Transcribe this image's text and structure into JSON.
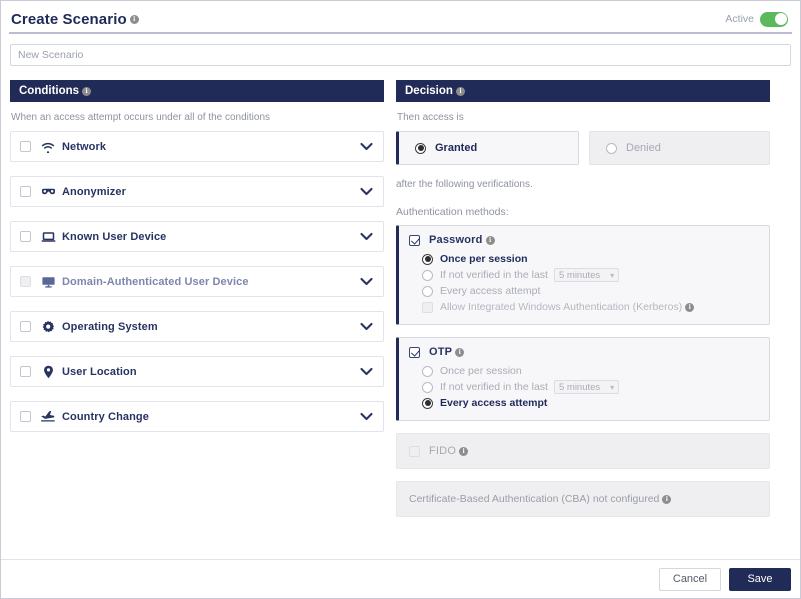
{
  "header": {
    "title": "Create Scenario",
    "info_icon": "info-icon",
    "active_label": "Active",
    "active_state": "on"
  },
  "scenario_name": {
    "value": "",
    "placeholder": "New Scenario"
  },
  "conditions": {
    "panel_title": "Conditions",
    "hint": "When an access attempt occurs under all of the conditions",
    "items": [
      {
        "label": "Network",
        "icon": "wifi-icon",
        "checked": false,
        "dim": false
      },
      {
        "label": "Anonymizer",
        "icon": "mask-icon",
        "checked": false,
        "dim": false
      },
      {
        "label": "Known User Device",
        "icon": "laptop-icon",
        "checked": false,
        "dim": false
      },
      {
        "label": "Domain-Authenticated User Device",
        "icon": "monitor-icon",
        "checked": false,
        "dim": true
      },
      {
        "label": "Operating System",
        "icon": "gear-icon",
        "checked": false,
        "dim": false
      },
      {
        "label": "User Location",
        "icon": "map-pin-icon",
        "checked": false,
        "dim": false
      },
      {
        "label": "Country Change",
        "icon": "airplane-icon",
        "checked": false,
        "dim": false
      }
    ]
  },
  "decision": {
    "panel_title": "Decision",
    "then_label": "Then access is",
    "granted_label": "Granted",
    "denied_label": "Denied",
    "selected": "Granted",
    "after_note": "after the following verifications.",
    "auth_methods_label": "Authentication methods:",
    "password": {
      "title": "Password",
      "checked": true,
      "options": [
        {
          "label": "Once per session",
          "selected": true
        },
        {
          "label": "If not verified in the last",
          "selected": false,
          "select_value": "5 minutes"
        },
        {
          "label": "Every access attempt",
          "selected": false
        }
      ],
      "kerberos_label": "Allow Integrated Windows Authentication (Kerberos)",
      "kerberos_checked": false
    },
    "otp": {
      "title": "OTP",
      "checked": true,
      "options": [
        {
          "label": "Once per session",
          "selected": false
        },
        {
          "label": "If not verified in the last",
          "selected": false,
          "select_value": "5 minutes"
        },
        {
          "label": "Every access attempt",
          "selected": true
        }
      ]
    },
    "fido": {
      "title": "FIDO",
      "checked": false,
      "disabled": true
    },
    "cba": {
      "note": "Certificate-Based Authentication (CBA) not configured"
    }
  },
  "footer": {
    "cancel_label": "Cancel",
    "save_label": "Save"
  },
  "colors": {
    "navy": "#212b57",
    "toggle_green": "#5cb85c",
    "muted": "#8e939f"
  }
}
